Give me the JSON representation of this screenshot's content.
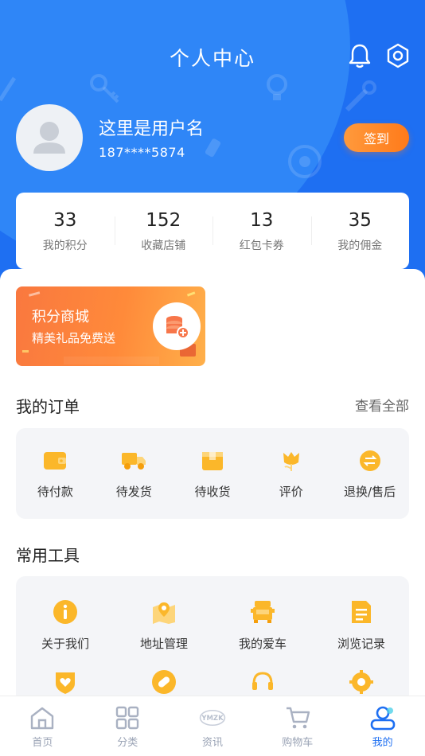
{
  "header": {
    "title": "个人中心",
    "bell_icon": "bell-icon",
    "settings_icon": "gear-icon"
  },
  "profile": {
    "username": "这里是用户名",
    "phone": "187****5874",
    "checkin_label": "签到"
  },
  "stats": [
    {
      "value": "33",
      "label": "我的积分"
    },
    {
      "value": "152",
      "label": "收藏店铺"
    },
    {
      "value": "13",
      "label": "红包卡券"
    },
    {
      "value": "35",
      "label": "我的佣金"
    }
  ],
  "promo": {
    "title": "积分商城",
    "subtitle": "精美礼品免费送",
    "icon": "coin-stack-icon"
  },
  "orders": {
    "title": "我的订单",
    "see_all": "查看全部",
    "items": [
      {
        "label": "待付款",
        "icon": "wallet-icon"
      },
      {
        "label": "待发货",
        "icon": "truck-icon"
      },
      {
        "label": "待收货",
        "icon": "box-icon"
      },
      {
        "label": "评价",
        "icon": "flower-icon"
      },
      {
        "label": "退换/售后",
        "icon": "exchange-icon"
      }
    ]
  },
  "tools": {
    "title": "常用工具",
    "items": [
      {
        "label": "关于我们",
        "icon": "info-icon"
      },
      {
        "label": "地址管理",
        "icon": "map-pin-icon"
      },
      {
        "label": "我的爱车",
        "icon": "truck-front-icon"
      },
      {
        "label": "浏览记录",
        "icon": "document-icon"
      },
      {
        "label": "",
        "icon": "heart-shield-icon"
      },
      {
        "label": "",
        "icon": "pill-icon"
      },
      {
        "label": "",
        "icon": "headset-icon"
      },
      {
        "label": "",
        "icon": "cog-icon"
      }
    ]
  },
  "tabbar": {
    "items": [
      {
        "label": "首页",
        "icon": "home-icon"
      },
      {
        "label": "分类",
        "icon": "grid-icon"
      },
      {
        "label": "资讯",
        "icon": "ymzk-logo-icon",
        "logo_text": "YMZK"
      },
      {
        "label": "购物车",
        "icon": "cart-icon"
      },
      {
        "label": "我的",
        "icon": "user-icon",
        "active": true
      }
    ]
  },
  "colors": {
    "brand_blue": "#1e6ff2",
    "accent_orange": "#ff8a1f",
    "icon_yellow": "#fbb72a"
  }
}
